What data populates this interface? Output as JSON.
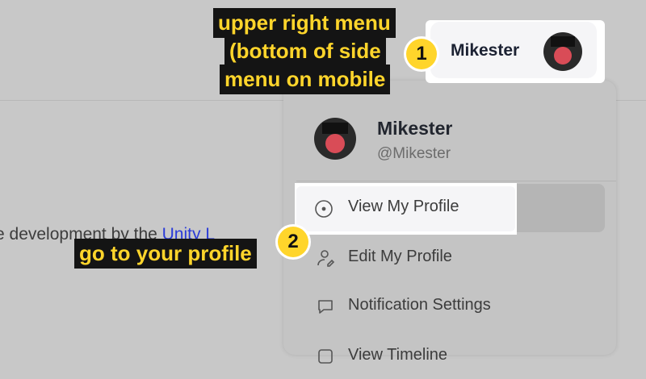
{
  "page": {
    "body_text_before": "e development by the ",
    "body_link": "Unity L"
  },
  "user": {
    "name": "Mikester",
    "handle": "@Mikester"
  },
  "menu": {
    "items": [
      {
        "label": "View My Profile",
        "icon": "circle-dot-icon"
      },
      {
        "label": "Edit My Profile",
        "icon": "user-edit-icon"
      },
      {
        "label": "Notification Settings",
        "icon": "chat-bubble-icon"
      },
      {
        "label": "View Timeline",
        "icon": "timeline-icon"
      }
    ]
  },
  "annotations": {
    "step1": {
      "number": "1",
      "lines": [
        "upper right menu",
        "(bottom of side",
        "menu on mobile"
      ]
    },
    "step2": {
      "number": "2",
      "text": "go to your profile"
    }
  },
  "colors": {
    "highlight": "#ffd52b",
    "callout_bg": "#141414",
    "link": "#2a3bd8"
  }
}
